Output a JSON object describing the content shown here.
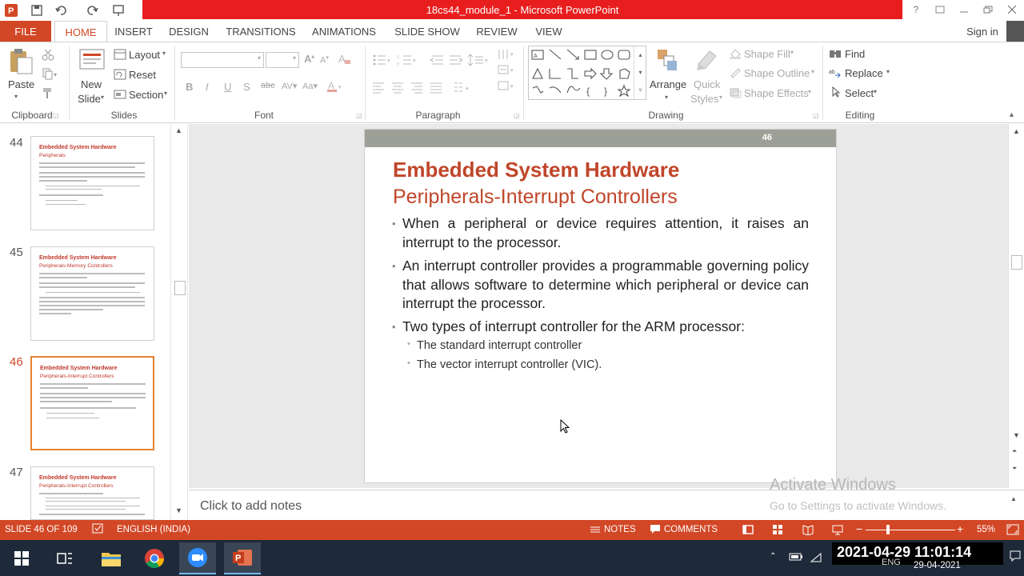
{
  "window": {
    "title": "18cs44_module_1 -  Microsoft PowerPoint",
    "help": "?"
  },
  "tabs": [
    "FILE",
    "HOME",
    "INSERT",
    "DESIGN",
    "TRANSITIONS",
    "ANIMATIONS",
    "SLIDE SHOW",
    "REVIEW",
    "VIEW"
  ],
  "signin": "Sign in",
  "ribbon": {
    "clipboard": {
      "paste": "Paste",
      "label": "Clipboard"
    },
    "slides": {
      "new_slide_1": "New",
      "new_slide_2": "Slide",
      "layout": "Layout",
      "reset": "Reset",
      "section": "Section",
      "label": "Slides"
    },
    "font": {
      "bold": "B",
      "italic": "I",
      "underline": "U",
      "strike": "S",
      "label": "Font"
    },
    "paragraph": {
      "label": "Paragraph"
    },
    "drawing": {
      "arrange": "Arrange",
      "quick_1": "Quick",
      "quick_2": "Styles",
      "shape_fill": "Shape Fill",
      "shape_outline": "Shape Outline",
      "shape_effects": "Shape Effects",
      "label": "Drawing"
    },
    "editing": {
      "find": "Find",
      "replace": "Replace",
      "select": "Select",
      "label": "Editing"
    }
  },
  "thumbnails": [
    {
      "num": "44",
      "title": "Embedded System Hardware",
      "subtitle": "Peripherals"
    },
    {
      "num": "45",
      "title": "Embedded System Hardware",
      "subtitle": "Peripherals-Memory Controllers"
    },
    {
      "num": "46",
      "title": "Embedded System Hardware",
      "subtitle": "Peripherals-Interrupt Controllers"
    },
    {
      "num": "47",
      "title": "Embedded System Hardware",
      "subtitle": "Peripherals-Interrupt Controllers"
    }
  ],
  "slide": {
    "number": "46",
    "title": "Embedded System Hardware",
    "subtitle": "Peripherals-Interrupt Controllers",
    "bullets": [
      "When a peripheral or device requires attention, it raises an interrupt to the processor.",
      "An interrupt controller provides a programmable governing policy that allows software to determine which peripheral or device can interrupt the processor.",
      "Two types of interrupt controller for the ARM processor:"
    ],
    "subbullets": [
      "The standard interrupt controller",
      "The vector interrupt controller (VIC)."
    ]
  },
  "notes": {
    "placeholder": "Click to add notes"
  },
  "watermark": {
    "line1": "Activate Windows",
    "line2": "Go to Settings to activate Windows."
  },
  "status": {
    "slide": "SLIDE 46 OF 109",
    "language": "ENGLISH (INDIA)",
    "notes": "NOTES",
    "comments": "COMMENTS",
    "zoom": "55%"
  },
  "taskbar": {
    "datetime": "2021-04-29 11:01:14",
    "lang": "ENG",
    "date": "29-04-2021"
  },
  "colors": {
    "accent": "#d24726",
    "titlebar": "#e81e1e",
    "slide_title": "#c0462a",
    "slide_header_bar": "#9da096"
  }
}
